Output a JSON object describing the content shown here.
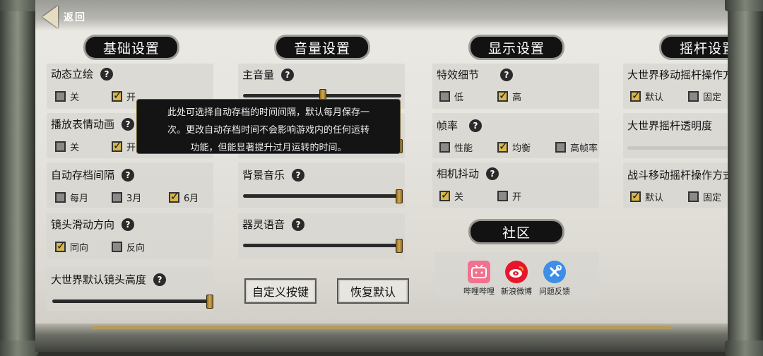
{
  "back": {
    "label": "返回"
  },
  "sections": {
    "basic": "基础设置",
    "volume": "音量设置",
    "display": "显示设置",
    "joystick": "摇杆设置",
    "community": "社区"
  },
  "basic": {
    "dynamic_portrait": {
      "label": "动态立绘",
      "options": [
        "关",
        "开"
      ],
      "selected": "开"
    },
    "emote_anim": {
      "label": "播放表情动画",
      "options": [
        "关",
        "开"
      ],
      "selected": "开"
    },
    "autosave": {
      "label": "自动存档间隔",
      "options": [
        "每月",
        "3月",
        "6月"
      ],
      "selected": "6月"
    },
    "camera_dir": {
      "label": "镜头滑动方向",
      "options": [
        "同向",
        "反向"
      ],
      "selected": "同向"
    },
    "world_cam_height": {
      "label": "大世界默认镜头高度",
      "value": 1.0
    }
  },
  "volume": {
    "master": {
      "label": "主音量",
      "value": 0.5
    },
    "sfx": {
      "value": 1.0
    },
    "bgm": {
      "label": "背景音乐",
      "value": 1.0
    },
    "voice": {
      "label": "器灵语音",
      "value": 1.0
    },
    "custom_keys_button": "自定义按键",
    "restore_default_button": "恢复默认"
  },
  "display": {
    "effects": {
      "label": "特效细节",
      "options": [
        "低",
        "高"
      ],
      "selected": "高"
    },
    "framerate": {
      "label": "帧率",
      "options": [
        "性能",
        "均衡",
        "高帧率"
      ],
      "selected": "均衡"
    },
    "camera_shake": {
      "label": "相机抖动",
      "options": [
        "关",
        "开"
      ],
      "selected": "关"
    }
  },
  "joystick": {
    "world_move": {
      "label": "大世界移动摇杆操作方",
      "options": [
        "默认",
        "固定"
      ],
      "selected": "默认"
    },
    "world_opacity": {
      "label": "大世界摇杆透明度"
    },
    "battle_move": {
      "label": "战斗移动摇杆操作方式",
      "options": [
        "默认",
        "固定"
      ],
      "selected": "默认"
    }
  },
  "community": {
    "bilibili": "哔哩哔哩",
    "weibo": "新浪微博",
    "feedback": "问题反馈"
  },
  "tooltip": {
    "line1": "此处可选择自动存档的时间间隔，默认每月保存一",
    "line2": "次。更改自动存档时间不会影响游戏内的任何运转",
    "line3": "功能，但能显著提升过月运转的时间。"
  },
  "colors": {
    "accent": "#d8b64a",
    "header_bg": "#121212",
    "bilibili": "#f0728f",
    "weibo": "#e6162d",
    "feedback": "#3d8ee6"
  }
}
